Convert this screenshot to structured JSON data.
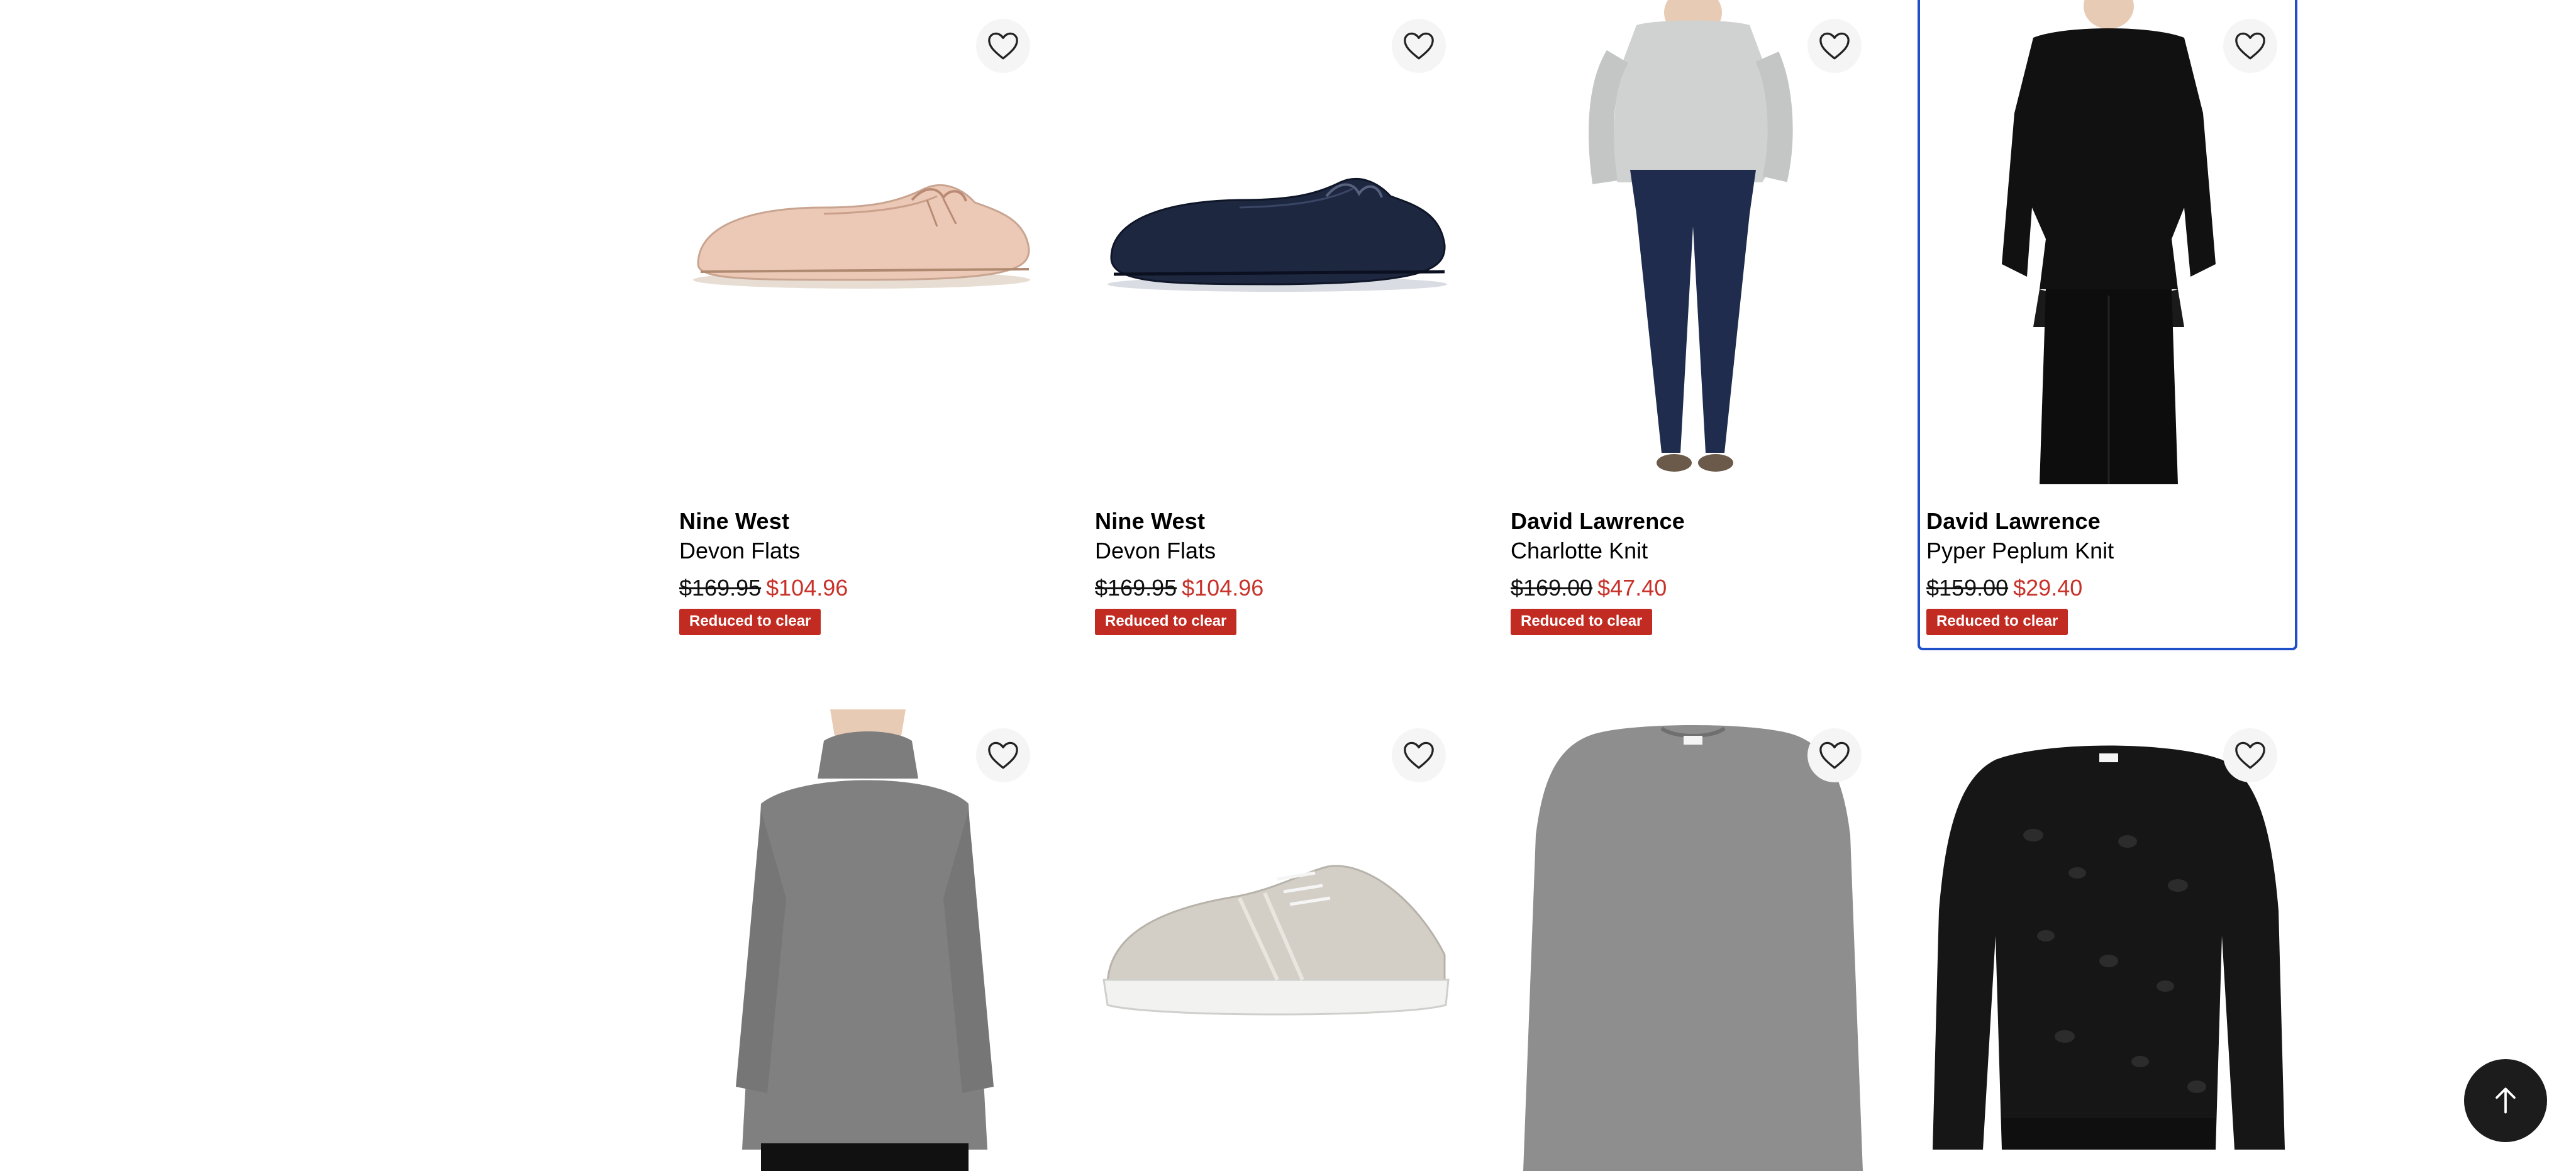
{
  "products": [
    {
      "brand": "Nine West",
      "name": "Devon Flats",
      "price_original": "$169.95",
      "price_sale": "$104.96",
      "badge": "Reduced to clear",
      "image": "shoe-loafer-blush-image"
    },
    {
      "brand": "Nine West",
      "name": "Devon Flats",
      "price_original": "$169.95",
      "price_sale": "$104.96",
      "badge": "Reduced to clear",
      "image": "shoe-loafer-navy-image"
    },
    {
      "brand": "David Lawrence",
      "name": "Charlotte Knit",
      "price_original": "$169.00",
      "price_sale": "$47.40",
      "badge": "Reduced to clear",
      "image": "grey-knit-model-image"
    },
    {
      "brand": "David Lawrence",
      "name": "Pyper Peplum Knit",
      "price_original": "$159.00",
      "price_sale": "$29.40",
      "badge": "Reduced to clear",
      "image": "black-peplum-knit-model-image"
    },
    {
      "image": "grey-turtleneck-model-image"
    },
    {
      "image": "grey-sneaker-image"
    },
    {
      "image": "grey-marle-sweater-image"
    },
    {
      "image": "black-leopard-sweater-image"
    }
  ],
  "icons": {
    "favourite": "heart-outline-icon",
    "back_to_top": "arrow-up-icon"
  },
  "colors": {
    "sale_price": "#c8322a",
    "badge_bg": "#c22b22",
    "selected_outline": "#1f4fc9",
    "back_to_top_bg": "#1c1c1c"
  }
}
